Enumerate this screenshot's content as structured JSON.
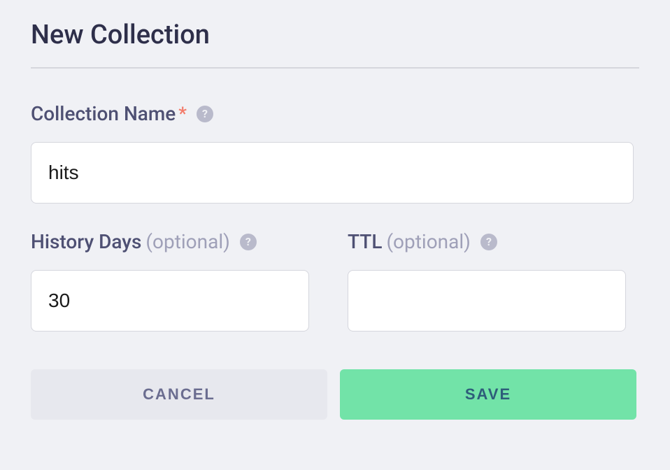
{
  "title": "New Collection",
  "fields": {
    "collectionName": {
      "label": "Collection Name",
      "required": true,
      "value": "hits",
      "placeholder": ""
    },
    "historyDays": {
      "label": "History Days",
      "optional": "(optional)",
      "value": "30",
      "placeholder": ""
    },
    "ttl": {
      "label": "TTL",
      "optional": "(optional)",
      "value": "",
      "placeholder": ""
    }
  },
  "buttons": {
    "cancel": "CANCEL",
    "save": "SAVE"
  },
  "icons": {
    "help": "?"
  }
}
